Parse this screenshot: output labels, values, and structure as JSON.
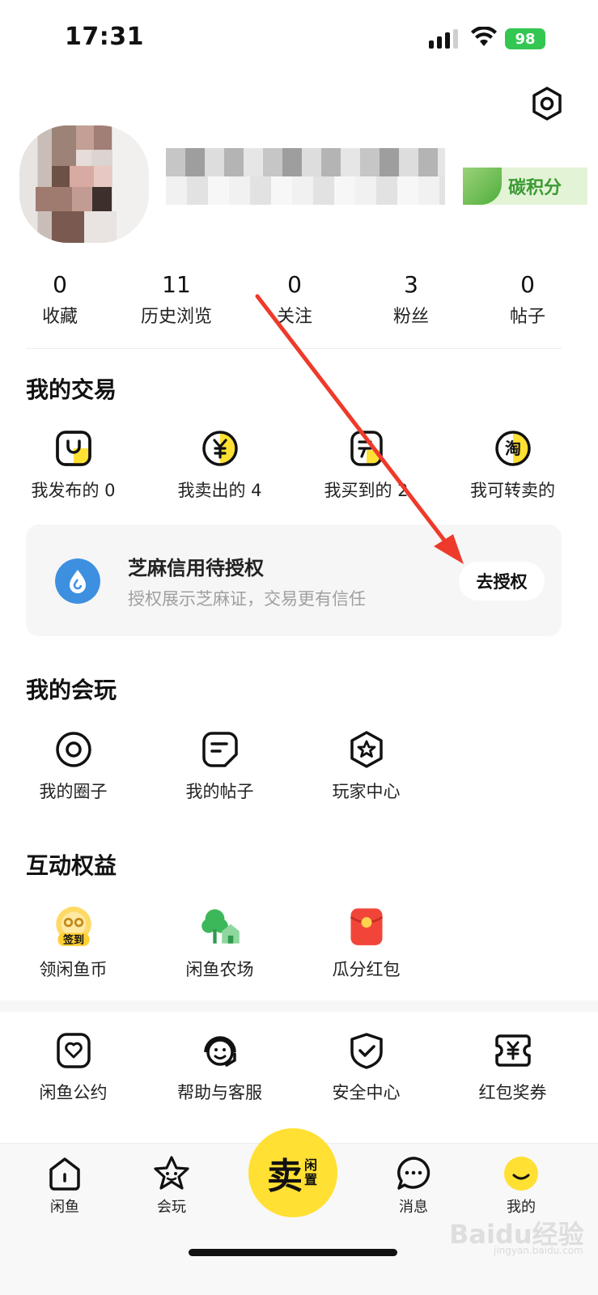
{
  "status_bar": {
    "time": "17:31",
    "battery": "98"
  },
  "profile": {
    "carbon_label": "碳积分"
  },
  "stats": [
    {
      "value": "0",
      "label": "收藏"
    },
    {
      "value": "11",
      "label": "历史浏览"
    },
    {
      "value": "0",
      "label": "关注"
    },
    {
      "value": "3",
      "label": "粉丝"
    },
    {
      "value": "0",
      "label": "帖子"
    }
  ],
  "trade": {
    "title": "我的交易",
    "items": [
      {
        "label": "我发布的 0",
        "icon": "bag-icon"
      },
      {
        "label": "我卖出的 4",
        "icon": "yuan-coin-icon"
      },
      {
        "label": "我买到的 2",
        "icon": "purchase-icon"
      },
      {
        "label": "我可转卖的",
        "icon": "taobao-icon",
        "icon_text": "淘"
      }
    ]
  },
  "sesame": {
    "title": "芝麻信用待授权",
    "subtitle": "授权展示芝麻证，交易更有信任",
    "button": "去授权"
  },
  "play": {
    "title": "我的会玩",
    "items": [
      {
        "label": "我的圈子",
        "icon": "circle-icon"
      },
      {
        "label": "我的帖子",
        "icon": "post-icon"
      },
      {
        "label": "玩家中心",
        "icon": "star-badge-icon"
      }
    ]
  },
  "benefits": {
    "title": "互动权益",
    "items": [
      {
        "label": "领闲鱼币",
        "icon": "checkin-coin-icon",
        "badge": "签到"
      },
      {
        "label": "闲鱼农场",
        "icon": "farm-icon"
      },
      {
        "label": "瓜分红包",
        "icon": "red-packet-icon"
      }
    ]
  },
  "services": [
    {
      "label": "闲鱼公约",
      "icon": "heart-shield-icon"
    },
    {
      "label": "帮助与客服",
      "icon": "customer-service-icon"
    },
    {
      "label": "安全中心",
      "icon": "security-check-icon"
    },
    {
      "label": "红包奖券",
      "icon": "coupon-icon"
    }
  ],
  "tabbar": {
    "items": [
      {
        "label": "闲鱼",
        "icon": "home-icon"
      },
      {
        "label": "会玩",
        "icon": "play-star-icon"
      },
      {
        "label": "消息",
        "icon": "message-icon"
      },
      {
        "label": "我的",
        "icon": "profile-smile-icon"
      }
    ],
    "sell_big": "卖",
    "sell_small": "闲置"
  },
  "colors": {
    "accent_yellow": "#ffe033",
    "annotation_red": "#ee3a2b",
    "sesame_blue": "#3d8fe0"
  },
  "watermark": {
    "main": "Baidu经验",
    "sub": "jingyan.baidu.com"
  }
}
